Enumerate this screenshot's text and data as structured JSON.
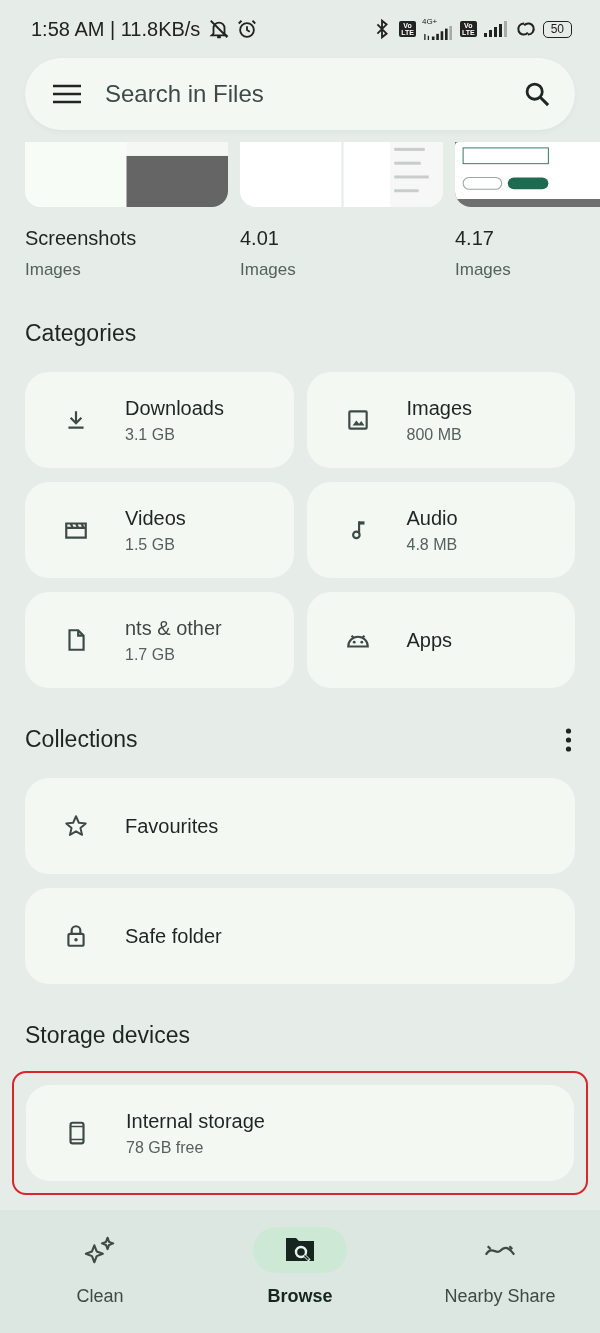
{
  "status_bar": {
    "time_speed": "1:58 AM | 11.8KB/s",
    "sim1_badge": [
      "Vo",
      "LTE"
    ],
    "network_type": "4G+",
    "sim2_badge": [
      "Vo",
      "LTE"
    ],
    "battery": "50"
  },
  "search": {
    "placeholder": "Search in Files"
  },
  "recent": [
    {
      "title": "Screenshots",
      "subtitle": "Images",
      "kind": "picture"
    },
    {
      "title": "4.01",
      "subtitle": "Images",
      "kind": "picture"
    },
    {
      "title": "4.17",
      "subtitle": "Images",
      "kind": "picture"
    }
  ],
  "categories": {
    "title": "Categories",
    "items": [
      {
        "kind": "downloads",
        "label": "Downloads",
        "size": "3.1 GB"
      },
      {
        "kind": "images",
        "label": "Images",
        "size": "800 MB"
      },
      {
        "kind": "videos",
        "label": "Videos",
        "size": "1.5 GB"
      },
      {
        "kind": "audio",
        "label": "Audio",
        "size": "4.8 MB"
      },
      {
        "kind": "documents",
        "label": "nts & other",
        "size": "1.7 GB"
      },
      {
        "kind": "apps",
        "label": "Apps"
      }
    ]
  },
  "collections": {
    "title": "Collections",
    "items": [
      {
        "kind": "favourites",
        "label": "Favourites"
      },
      {
        "kind": "safe",
        "label": "Safe folder"
      }
    ]
  },
  "storage_devices": {
    "title": "Storage devices",
    "items": [
      {
        "kind": "phone",
        "label": "Internal storage",
        "detail": "78 GB free",
        "highlighted": true
      }
    ]
  },
  "bottom_nav": [
    {
      "kind": "clean",
      "label": "Clean",
      "selected": false
    },
    {
      "kind": "browse",
      "label": "Browse",
      "selected": true
    },
    {
      "kind": "nearby",
      "label": "Nearby Share",
      "selected": false
    }
  ]
}
